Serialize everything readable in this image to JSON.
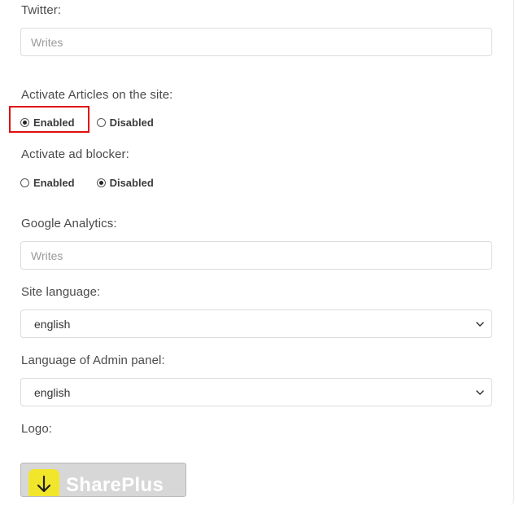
{
  "twitter": {
    "label": "Twitter:",
    "placeholder": "Writes",
    "value": ""
  },
  "articles": {
    "label": "Activate Articles on the site:",
    "options": [
      {
        "label": "Enabled",
        "checked": true
      },
      {
        "label": "Disabled",
        "checked": false
      }
    ]
  },
  "ad_blocker": {
    "label": "Activate ad blocker:",
    "options": [
      {
        "label": "Enabled",
        "checked": false
      },
      {
        "label": "Disabled",
        "checked": true
      }
    ]
  },
  "google_analytics": {
    "label": "Google Analytics:",
    "placeholder": "Writes",
    "value": ""
  },
  "site_language": {
    "label": "Site language:",
    "selected": "english"
  },
  "admin_language": {
    "label": "Language of Admin panel:",
    "selected": "english"
  },
  "logo": {
    "label": "Logo:",
    "image_text": "SharePlus",
    "icon": "download-arrow-icon"
  },
  "colors": {
    "highlight": "#e01010",
    "logo_icon_bg": "#f2e62b"
  }
}
